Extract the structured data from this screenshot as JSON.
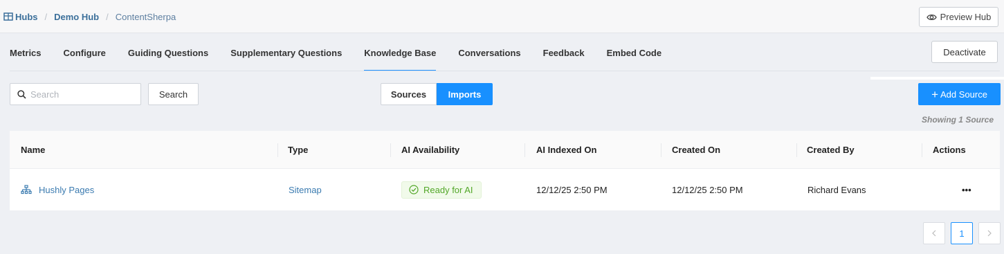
{
  "breadcrumb": {
    "hubs": "Hubs",
    "hub": "Demo Hub",
    "current": "ContentSherpa",
    "separator": "/"
  },
  "header": {
    "preview_label": "Preview Hub",
    "deactivate_label": "Deactivate"
  },
  "tabs": [
    {
      "label": "Metrics"
    },
    {
      "label": "Configure"
    },
    {
      "label": "Guiding Questions"
    },
    {
      "label": "Supplementary Questions"
    },
    {
      "label": "Knowledge Base",
      "active": true
    },
    {
      "label": "Conversations"
    },
    {
      "label": "Feedback"
    },
    {
      "label": "Embed Code"
    }
  ],
  "toolbar": {
    "search_placeholder": "Search",
    "search_value": "",
    "search_button": "Search",
    "segment_sources": "Sources",
    "segment_imports": "Imports",
    "segment_selected": "Imports",
    "add_label": "Add Source",
    "showing": "Showing 1 Source"
  },
  "table": {
    "columns": [
      "Name",
      "Type",
      "AI Availability",
      "AI Indexed On",
      "Created On",
      "Created By",
      "Actions"
    ],
    "rows": [
      {
        "name": "Hushly Pages",
        "type": "Sitemap",
        "ai_availability": "Ready for AI",
        "ai_indexed_on": "12/12/25 2:50 PM",
        "created_on": "12/12/25 2:50 PM",
        "created_by": "Richard Evans",
        "actions": "•••"
      }
    ]
  },
  "pagination": {
    "prev": "<",
    "current": "1",
    "next": ">"
  },
  "colors": {
    "accent": "#1890ff",
    "link": "#3b7bb0",
    "success": "#52a728",
    "page_bg": "#eef0f4"
  },
  "icons": [
    "table-grid-icon",
    "eye-icon",
    "search-icon",
    "plus-icon",
    "sitemap-icon",
    "check-circle-icon",
    "chevron-left-icon",
    "chevron-right-icon"
  ]
}
